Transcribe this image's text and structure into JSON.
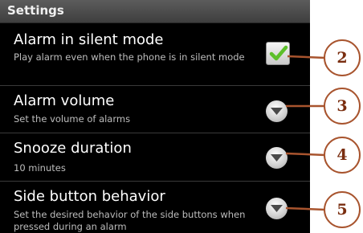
{
  "header": {
    "title": "Settings"
  },
  "settings": [
    {
      "title": "Alarm in silent mode",
      "summary": "Play alarm even when the phone is in silent mode",
      "control": "checkbox",
      "checked": true,
      "callout": "2"
    },
    {
      "title": "Alarm volume",
      "summary": "Set the volume of alarms",
      "control": "dropdown",
      "callout": "3"
    },
    {
      "title": "Snooze duration",
      "summary": "10 minutes",
      "control": "dropdown",
      "callout": "4"
    },
    {
      "title": "Side button behavior",
      "summary": "Set the desired behavior of the side buttons when pressed during an alarm",
      "control": "dropdown",
      "callout": "5"
    }
  ],
  "icons": {
    "checkbox_check": "check-icon",
    "dropdown_arrow": "chevron-down-icon"
  },
  "colors": {
    "check_green": "#5cbf2a",
    "callout_border": "#a8542e",
    "callout_text": "#7a2e10"
  }
}
